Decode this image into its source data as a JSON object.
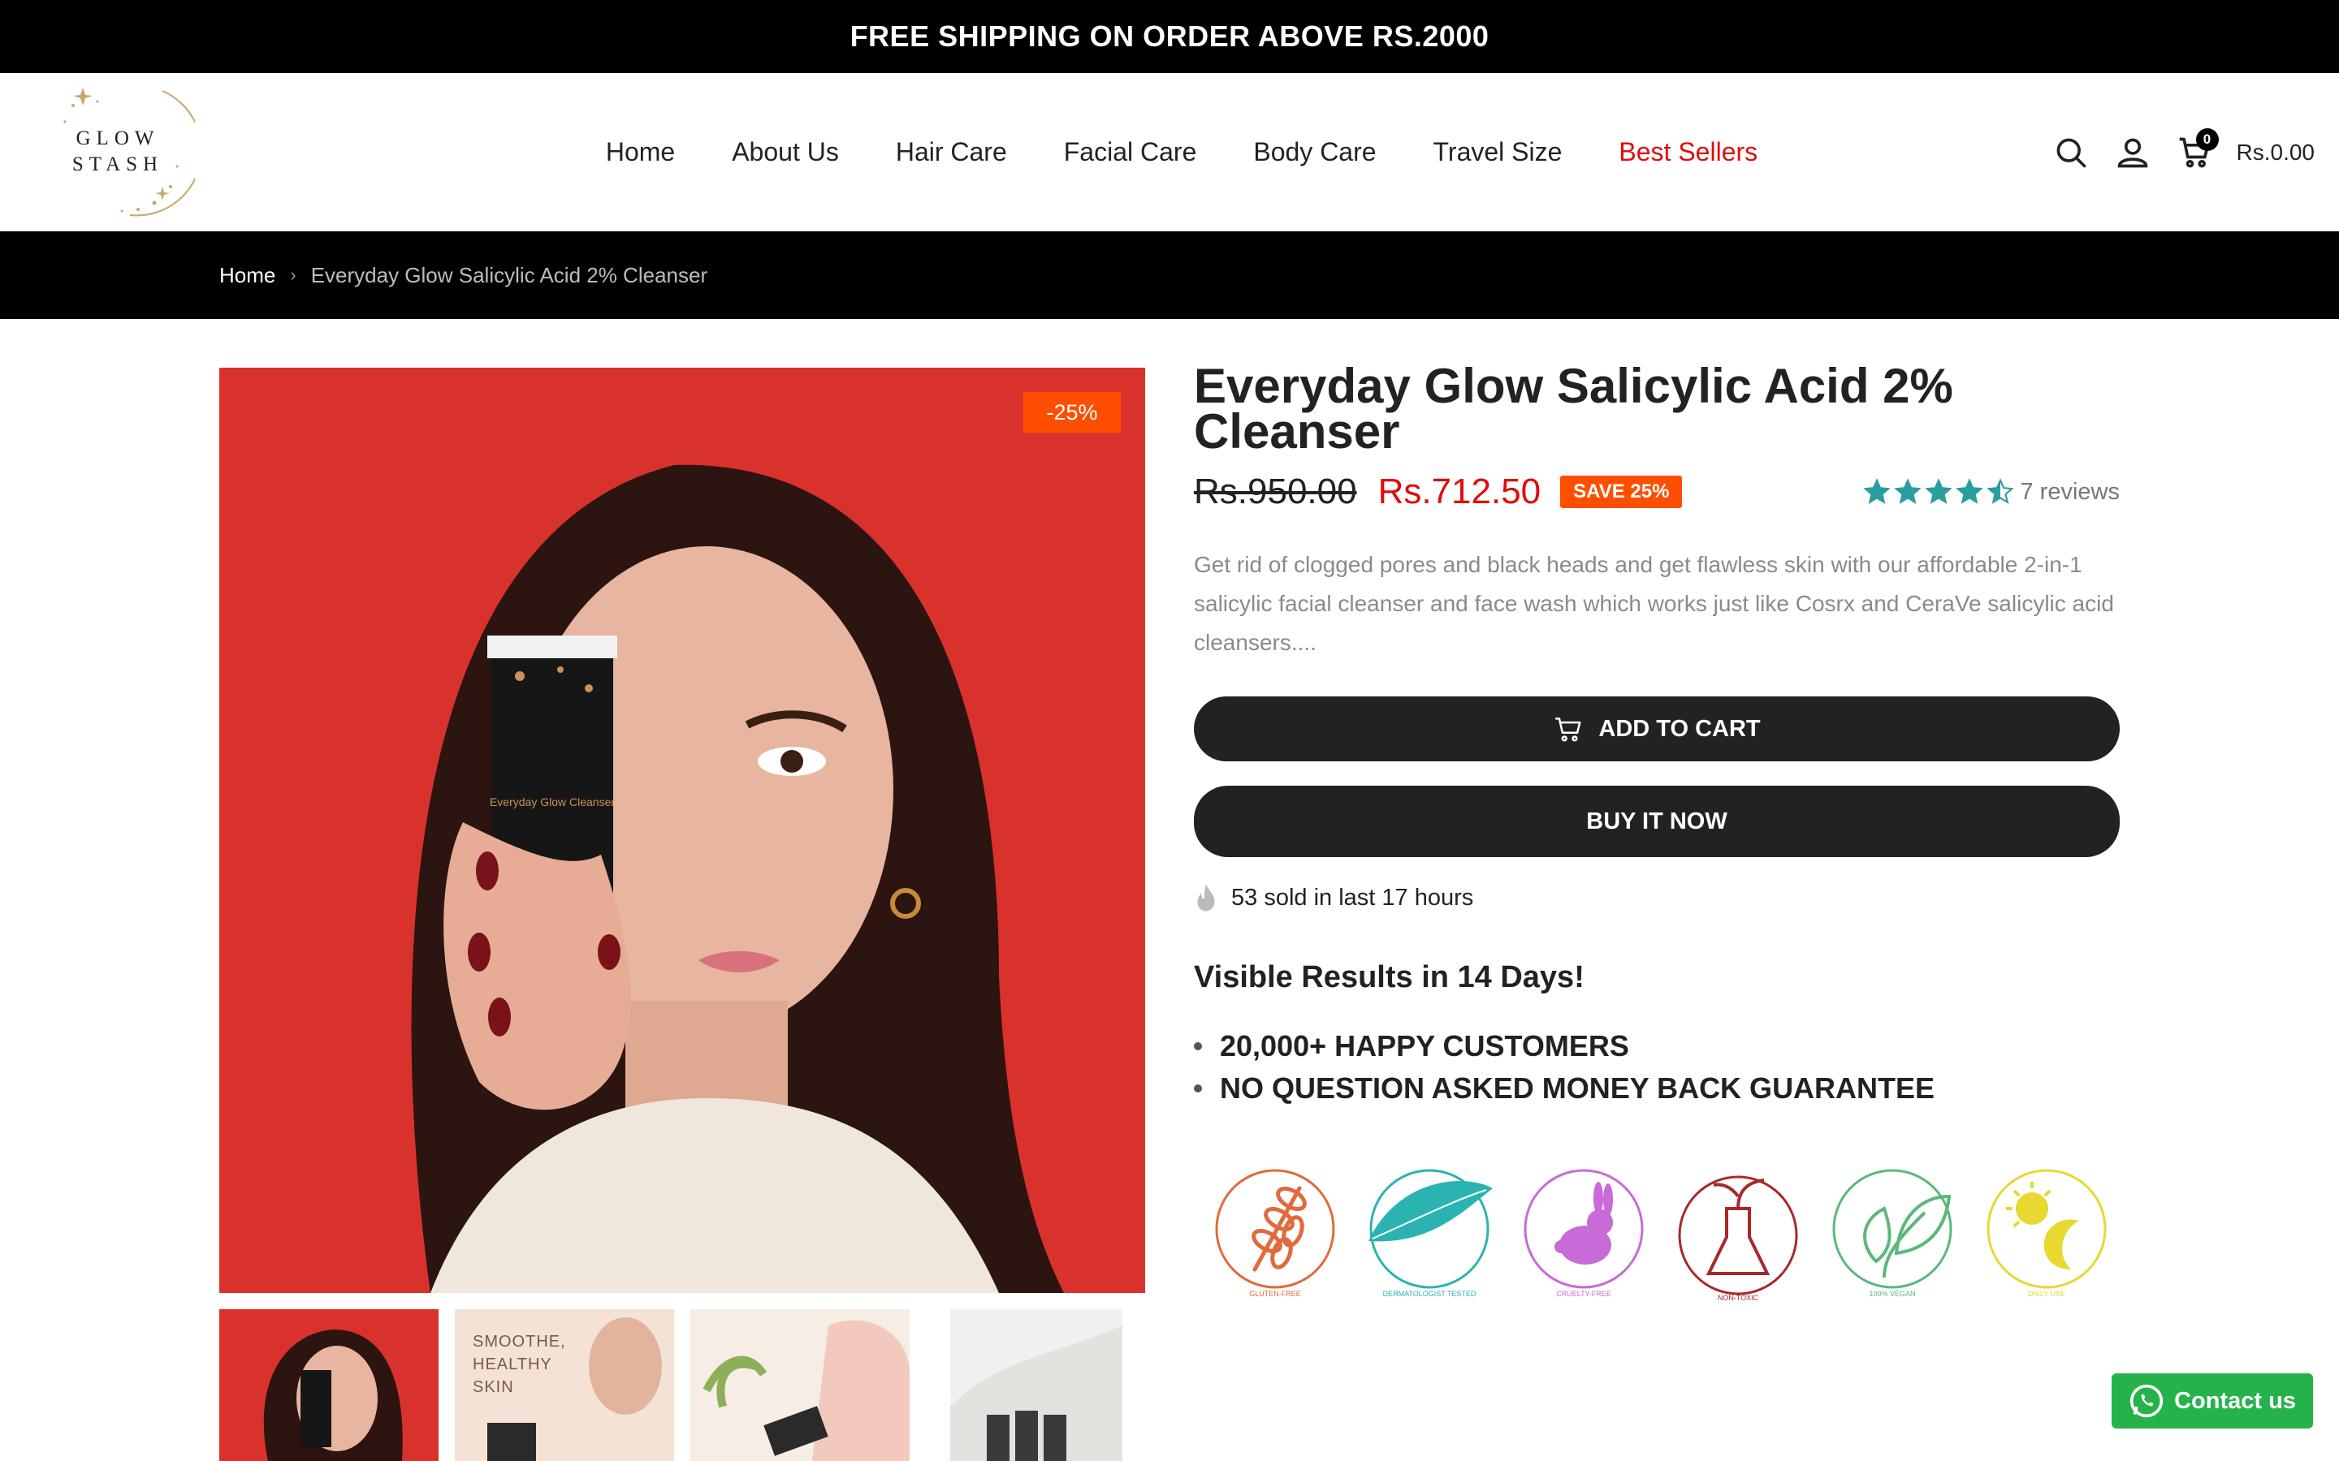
{
  "announcement": "FREE SHIPPING ON ORDER ABOVE RS.2000",
  "logo": {
    "line1": "GLOW",
    "line2": "STASH"
  },
  "nav": [
    {
      "label": "Home"
    },
    {
      "label": "About Us"
    },
    {
      "label": "Hair Care"
    },
    {
      "label": "Facial Care"
    },
    {
      "label": "Body Care"
    },
    {
      "label": "Travel Size"
    },
    {
      "label": "Best Sellers",
      "highlight": true
    }
  ],
  "header_icons": [
    "search-icon",
    "account-icon",
    "cart-icon"
  ],
  "cart": {
    "count": "0",
    "total": "Rs.0.00"
  },
  "breadcrumb": {
    "home": "Home",
    "current": "Everyday Glow Salicylic Acid 2% Cleanser"
  },
  "product": {
    "discount_badge": "-25%",
    "title": "Everyday Glow Salicylic Acid 2% Cleanser",
    "old_price": "Rs.950.00",
    "new_price": "Rs.712.50",
    "save_badge": "SAVE 25%",
    "rating": 4.5,
    "reviews": "7 reviews",
    "description": "Get rid of clogged pores and black heads and get flawless skin with our affordable 2-in-1 salicylic facial cleanser and face wash which works just like Cosrx and CeraVe salicylic acid cleansers....",
    "add_to_cart": "ADD TO CART",
    "buy_now": "BUY IT NOW",
    "sold_text": "53 sold in last 17 hours",
    "results_heading": "Visible Results in 14 Days!",
    "bullets": [
      "20,000+ HAPPY CUSTOMERS",
      "NO QUESTION ASKED MONEY BACK GUARANTEE"
    ],
    "badges": [
      {
        "label": "GLUTEN-FREE",
        "color": "#e06a3c"
      },
      {
        "label": "DERMATOLOGIST TESTED",
        "color": "#2bb3b1"
      },
      {
        "label": "CRUELTY-FREE",
        "color": "#c86ad8"
      },
      {
        "label": "NON-TOXIC",
        "color": "#a8282a"
      },
      {
        "label": "100% VEGAN",
        "color": "#5cb87a"
      },
      {
        "label": "DAILY USE",
        "color": "#e9d830"
      }
    ],
    "thumb2_text": "SMOOTHE,\nHEALTHY\nSKIN",
    "tube_text": "Everyday Glow Cleanser"
  },
  "contact": "Contact us",
  "colors": {
    "sale": "#e10c0c",
    "badge": "#ff4e00",
    "star": "#2a9d9f",
    "whatsapp": "#26b24b"
  }
}
